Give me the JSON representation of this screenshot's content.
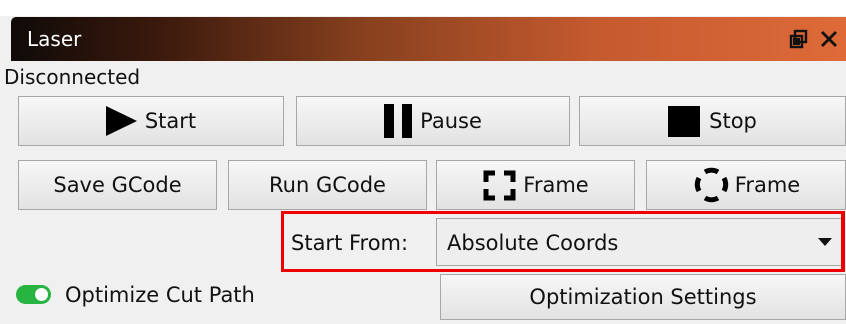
{
  "window": {
    "title": "Laser",
    "controls": {
      "float_icon": "float-window-icon",
      "close_icon": "close-icon"
    }
  },
  "status": {
    "text": "Disconnected"
  },
  "controls_row_1": {
    "start": {
      "label": "Start",
      "icon": "play-icon"
    },
    "pause": {
      "label": "Pause",
      "icon": "pause-icon"
    },
    "stop": {
      "label": "Stop",
      "icon": "stop-icon"
    }
  },
  "controls_row_2": {
    "save_gcode": "Save GCode",
    "run_gcode": "Run GCode",
    "frame_rect": {
      "label": "Frame",
      "icon": "rectangular-frame-icon"
    },
    "frame_circle": {
      "label": "Frame",
      "icon": "circular-frame-icon"
    }
  },
  "start_from": {
    "label": "Start From:",
    "selected": "Absolute Coords",
    "icon": "dropdown-arrow-icon"
  },
  "optimization": {
    "toggle_label": "Optimize Cut Path",
    "toggle_icon": "toggle-on-icon",
    "settings_button": "Optimization Settings"
  },
  "colors": {
    "highlight": "#ef0000",
    "toggle_on": "#28b441",
    "title_gradient_start": "#0f0a08",
    "title_gradient_end": "#de6a38"
  }
}
